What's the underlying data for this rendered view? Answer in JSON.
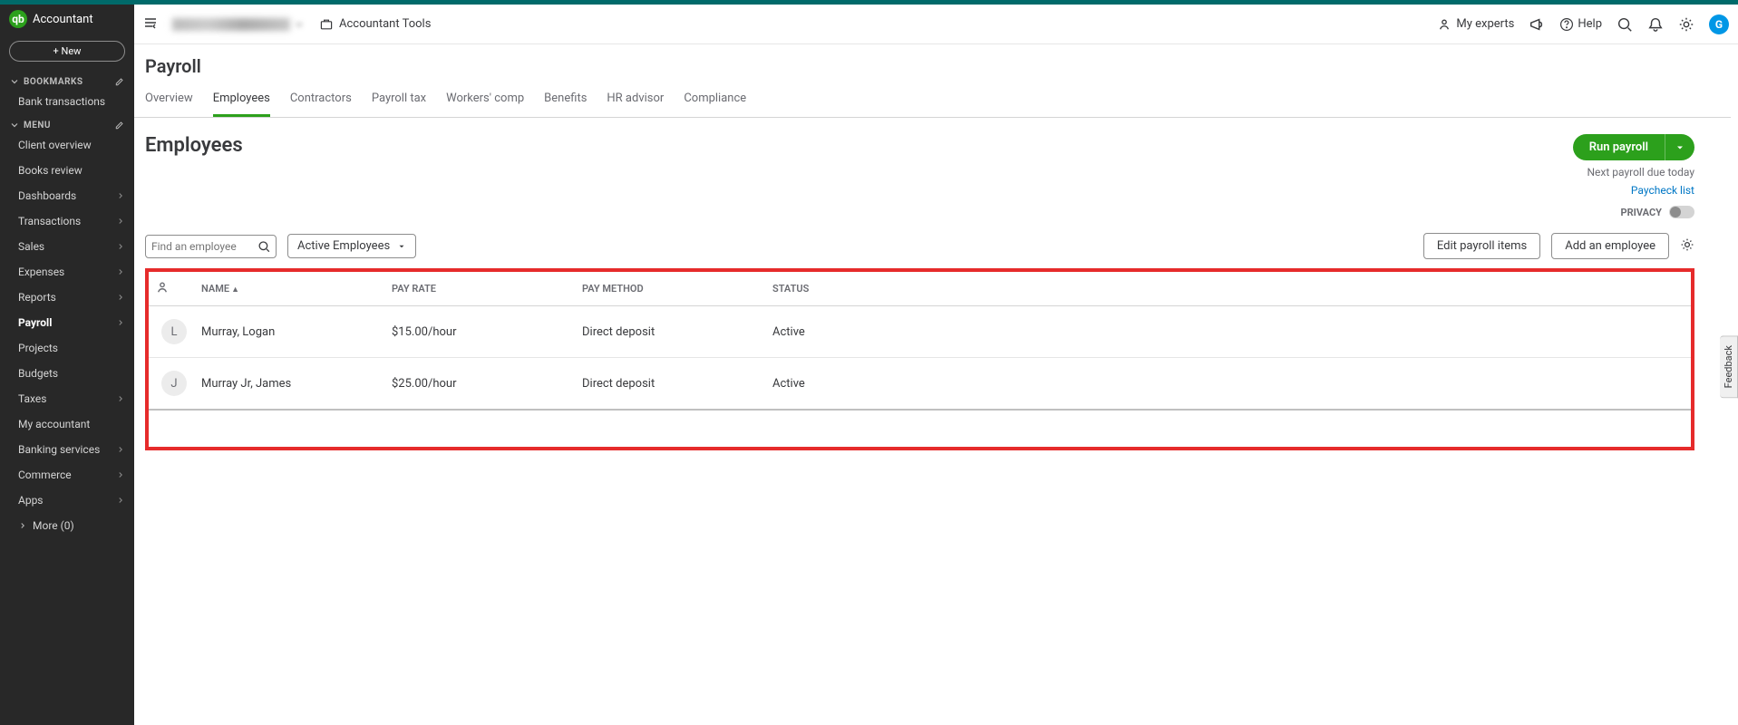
{
  "brand": "Accountant",
  "sidebar": {
    "new_button": "+  New",
    "bookmarks_label": "BOOKMARKS",
    "bookmark_items": [
      "Bank transactions"
    ],
    "menu_label": "MENU",
    "items": [
      {
        "label": "Client overview",
        "chev": false
      },
      {
        "label": "Books review",
        "chev": false
      },
      {
        "label": "Dashboards",
        "chev": true
      },
      {
        "label": "Transactions",
        "chev": true
      },
      {
        "label": "Sales",
        "chev": true
      },
      {
        "label": "Expenses",
        "chev": true
      },
      {
        "label": "Reports",
        "chev": true
      },
      {
        "label": "Payroll",
        "chev": true,
        "active": true
      },
      {
        "label": "Projects",
        "chev": false
      },
      {
        "label": "Budgets",
        "chev": false
      },
      {
        "label": "Taxes",
        "chev": true
      },
      {
        "label": "My accountant",
        "chev": false
      },
      {
        "label": "Banking services",
        "chev": true
      },
      {
        "label": "Commerce",
        "chev": true
      },
      {
        "label": "Apps",
        "chev": true
      }
    ],
    "more": "More (0)"
  },
  "topbar": {
    "accountant_tools": "Accountant Tools",
    "my_experts": "My experts",
    "help": "Help",
    "avatar_initial": "G"
  },
  "page": {
    "title": "Payroll",
    "tabs": [
      "Overview",
      "Employees",
      "Contractors",
      "Payroll tax",
      "Workers' comp",
      "Benefits",
      "HR advisor",
      "Compliance"
    ],
    "active_tab": 1,
    "section_title": "Employees",
    "run_payroll": "Run payroll",
    "next_due": "Next payroll due today",
    "paycheck_list": "Paycheck list",
    "privacy": "PRIVACY",
    "search_placeholder": "Find an employee",
    "filter": "Active Employees",
    "edit_items": "Edit payroll items",
    "add_employee": "Add an employee",
    "columns": {
      "name": "NAME",
      "payrate": "PAY RATE",
      "paymethod": "PAY METHOD",
      "status": "STATUS"
    },
    "employees": [
      {
        "initial": "L",
        "name": "Murray, Logan",
        "payrate": "$15.00/hour",
        "paymethod": "Direct deposit",
        "status": "Active"
      },
      {
        "initial": "J",
        "name": "Murray Jr, James",
        "payrate": "$25.00/hour",
        "paymethod": "Direct deposit",
        "status": "Active"
      }
    ]
  },
  "feedback": "Feedback"
}
